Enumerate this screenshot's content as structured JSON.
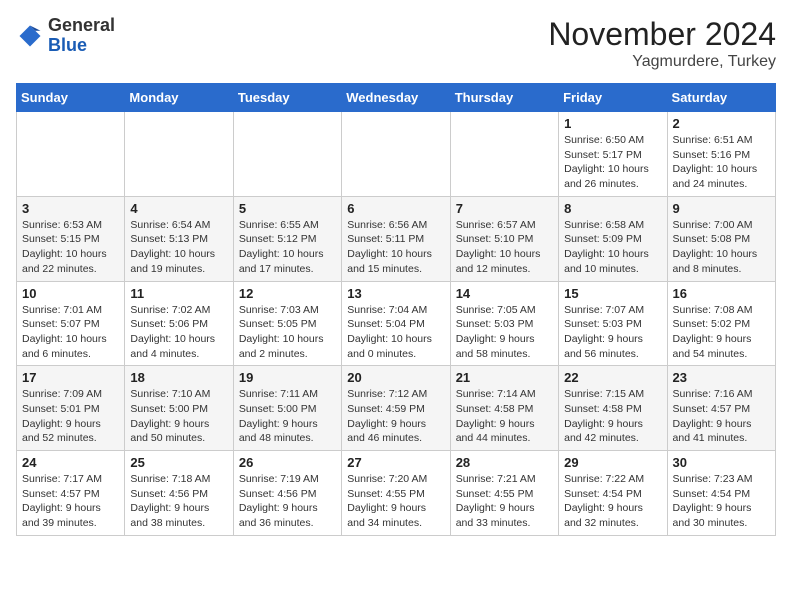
{
  "header": {
    "logo_general": "General",
    "logo_blue": "Blue",
    "month_title": "November 2024",
    "location": "Yagmurdere, Turkey"
  },
  "weekdays": [
    "Sunday",
    "Monday",
    "Tuesday",
    "Wednesday",
    "Thursday",
    "Friday",
    "Saturday"
  ],
  "weeks": [
    [
      {
        "day": "",
        "info": ""
      },
      {
        "day": "",
        "info": ""
      },
      {
        "day": "",
        "info": ""
      },
      {
        "day": "",
        "info": ""
      },
      {
        "day": "",
        "info": ""
      },
      {
        "day": "1",
        "info": "Sunrise: 6:50 AM\nSunset: 5:17 PM\nDaylight: 10 hours\nand 26 minutes."
      },
      {
        "day": "2",
        "info": "Sunrise: 6:51 AM\nSunset: 5:16 PM\nDaylight: 10 hours\nand 24 minutes."
      }
    ],
    [
      {
        "day": "3",
        "info": "Sunrise: 6:53 AM\nSunset: 5:15 PM\nDaylight: 10 hours\nand 22 minutes."
      },
      {
        "day": "4",
        "info": "Sunrise: 6:54 AM\nSunset: 5:13 PM\nDaylight: 10 hours\nand 19 minutes."
      },
      {
        "day": "5",
        "info": "Sunrise: 6:55 AM\nSunset: 5:12 PM\nDaylight: 10 hours\nand 17 minutes."
      },
      {
        "day": "6",
        "info": "Sunrise: 6:56 AM\nSunset: 5:11 PM\nDaylight: 10 hours\nand 15 minutes."
      },
      {
        "day": "7",
        "info": "Sunrise: 6:57 AM\nSunset: 5:10 PM\nDaylight: 10 hours\nand 12 minutes."
      },
      {
        "day": "8",
        "info": "Sunrise: 6:58 AM\nSunset: 5:09 PM\nDaylight: 10 hours\nand 10 minutes."
      },
      {
        "day": "9",
        "info": "Sunrise: 7:00 AM\nSunset: 5:08 PM\nDaylight: 10 hours\nand 8 minutes."
      }
    ],
    [
      {
        "day": "10",
        "info": "Sunrise: 7:01 AM\nSunset: 5:07 PM\nDaylight: 10 hours\nand 6 minutes."
      },
      {
        "day": "11",
        "info": "Sunrise: 7:02 AM\nSunset: 5:06 PM\nDaylight: 10 hours\nand 4 minutes."
      },
      {
        "day": "12",
        "info": "Sunrise: 7:03 AM\nSunset: 5:05 PM\nDaylight: 10 hours\nand 2 minutes."
      },
      {
        "day": "13",
        "info": "Sunrise: 7:04 AM\nSunset: 5:04 PM\nDaylight: 10 hours\nand 0 minutes."
      },
      {
        "day": "14",
        "info": "Sunrise: 7:05 AM\nSunset: 5:03 PM\nDaylight: 9 hours\nand 58 minutes."
      },
      {
        "day": "15",
        "info": "Sunrise: 7:07 AM\nSunset: 5:03 PM\nDaylight: 9 hours\nand 56 minutes."
      },
      {
        "day": "16",
        "info": "Sunrise: 7:08 AM\nSunset: 5:02 PM\nDaylight: 9 hours\nand 54 minutes."
      }
    ],
    [
      {
        "day": "17",
        "info": "Sunrise: 7:09 AM\nSunset: 5:01 PM\nDaylight: 9 hours\nand 52 minutes."
      },
      {
        "day": "18",
        "info": "Sunrise: 7:10 AM\nSunset: 5:00 PM\nDaylight: 9 hours\nand 50 minutes."
      },
      {
        "day": "19",
        "info": "Sunrise: 7:11 AM\nSunset: 5:00 PM\nDaylight: 9 hours\nand 48 minutes."
      },
      {
        "day": "20",
        "info": "Sunrise: 7:12 AM\nSunset: 4:59 PM\nDaylight: 9 hours\nand 46 minutes."
      },
      {
        "day": "21",
        "info": "Sunrise: 7:14 AM\nSunset: 4:58 PM\nDaylight: 9 hours\nand 44 minutes."
      },
      {
        "day": "22",
        "info": "Sunrise: 7:15 AM\nSunset: 4:58 PM\nDaylight: 9 hours\nand 42 minutes."
      },
      {
        "day": "23",
        "info": "Sunrise: 7:16 AM\nSunset: 4:57 PM\nDaylight: 9 hours\nand 41 minutes."
      }
    ],
    [
      {
        "day": "24",
        "info": "Sunrise: 7:17 AM\nSunset: 4:57 PM\nDaylight: 9 hours\nand 39 minutes."
      },
      {
        "day": "25",
        "info": "Sunrise: 7:18 AM\nSunset: 4:56 PM\nDaylight: 9 hours\nand 38 minutes."
      },
      {
        "day": "26",
        "info": "Sunrise: 7:19 AM\nSunset: 4:56 PM\nDaylight: 9 hours\nand 36 minutes."
      },
      {
        "day": "27",
        "info": "Sunrise: 7:20 AM\nSunset: 4:55 PM\nDaylight: 9 hours\nand 34 minutes."
      },
      {
        "day": "28",
        "info": "Sunrise: 7:21 AM\nSunset: 4:55 PM\nDaylight: 9 hours\nand 33 minutes."
      },
      {
        "day": "29",
        "info": "Sunrise: 7:22 AM\nSunset: 4:54 PM\nDaylight: 9 hours\nand 32 minutes."
      },
      {
        "day": "30",
        "info": "Sunrise: 7:23 AM\nSunset: 4:54 PM\nDaylight: 9 hours\nand 30 minutes."
      }
    ]
  ]
}
